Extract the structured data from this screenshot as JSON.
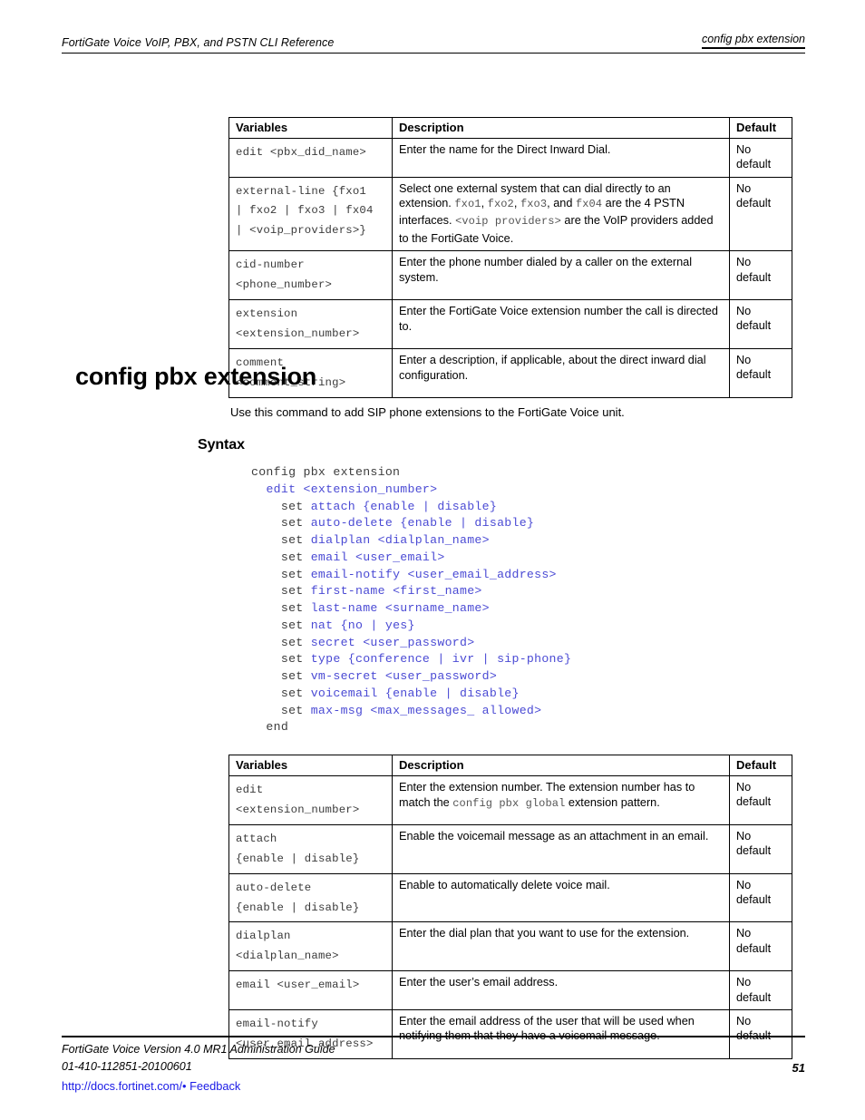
{
  "header": {
    "left": "FortiGate Voice VoIP, PBX, and PSTN CLI Reference",
    "right": "config pbx extension"
  },
  "table_did": {
    "columns": [
      "Variables",
      "Description",
      "Default"
    ],
    "rows": [
      {
        "variable": "edit <pbx_did_name>",
        "description": "Enter the name for the Direct Inward Dial.",
        "default": "No\ndefault"
      },
      {
        "variable": "external-line {fxo1\n| fxo2 | fxo3 | fx04\n| <voip_providers>}",
        "description_parts": [
          {
            "text": "Select one external system that can dial directly to an extension. ",
            "style": "plain"
          },
          {
            "text": "fxo1",
            "style": "mono"
          },
          {
            "text": ", ",
            "style": "plain"
          },
          {
            "text": "fxo2",
            "style": "mono"
          },
          {
            "text": ", ",
            "style": "plain"
          },
          {
            "text": "fxo3",
            "style": "mono"
          },
          {
            "text": ", and ",
            "style": "plain"
          },
          {
            "text": "fx04",
            "style": "mono"
          },
          {
            "text": " are the 4 PSTN interfaces. ",
            "style": "plain"
          },
          {
            "text": "<voip providers>",
            "style": "mono"
          },
          {
            "text": " are the VoIP providers added to the FortiGate Voice.",
            "style": "plain"
          }
        ],
        "default": "No\ndefault"
      },
      {
        "variable": "cid-number\n<phone_number>",
        "description": "Enter the phone number dialed by a caller on the external system.",
        "default": "No\ndefault"
      },
      {
        "variable": "extension\n<extension_number>",
        "description": "Enter the FortiGate Voice extension number the call is directed to.",
        "default": "No\ndefault"
      },
      {
        "variable": "comment\n<comment_string>",
        "description": "Enter a description, if applicable, about the direct inward dial configuration.",
        "default": "No\ndefault"
      }
    ]
  },
  "section": {
    "title": "config pbx extension",
    "intro": "Use this command to add SIP phone extensions to the FortiGate Voice unit.",
    "syntax_label": "Syntax"
  },
  "syntax": {
    "lines": [
      [
        {
          "t": "config pbx extension",
          "c": "kw"
        }
      ],
      [
        {
          "t": "  ",
          "c": "kw"
        },
        {
          "t": "edit <extension_number>",
          "c": "blue"
        }
      ],
      [
        {
          "t": "    set ",
          "c": "kw"
        },
        {
          "t": "attach {enable | disable}",
          "c": "blue"
        }
      ],
      [
        {
          "t": "    set ",
          "c": "kw"
        },
        {
          "t": "auto-delete {enable | disable}",
          "c": "blue"
        }
      ],
      [
        {
          "t": "    set ",
          "c": "kw"
        },
        {
          "t": "dialplan <dialplan_name>",
          "c": "blue"
        }
      ],
      [
        {
          "t": "    set ",
          "c": "kw"
        },
        {
          "t": "email <user_email>",
          "c": "blue"
        }
      ],
      [
        {
          "t": "    set ",
          "c": "kw"
        },
        {
          "t": "email-notify <user_email_address>",
          "c": "blue"
        }
      ],
      [
        {
          "t": "    set ",
          "c": "kw"
        },
        {
          "t": "first-name <first_name>",
          "c": "blue"
        }
      ],
      [
        {
          "t": "    set ",
          "c": "kw"
        },
        {
          "t": "last-name <surname_name>",
          "c": "blue"
        }
      ],
      [
        {
          "t": "    set ",
          "c": "kw"
        },
        {
          "t": "nat {no | yes}",
          "c": "blue"
        }
      ],
      [
        {
          "t": "    set ",
          "c": "kw"
        },
        {
          "t": "secret <user_password>",
          "c": "blue"
        }
      ],
      [
        {
          "t": "    set ",
          "c": "kw"
        },
        {
          "t": "type {conference | ivr | sip-phone}",
          "c": "blue"
        }
      ],
      [
        {
          "t": "    set ",
          "c": "kw"
        },
        {
          "t": "vm-secret <user_password>",
          "c": "blue"
        }
      ],
      [
        {
          "t": "    set ",
          "c": "kw"
        },
        {
          "t": "voicemail {enable | disable}",
          "c": "blue"
        }
      ],
      [
        {
          "t": "    set ",
          "c": "kw"
        },
        {
          "t": "max-msg <max_messages_ allowed>",
          "c": "blue"
        }
      ],
      [
        {
          "t": "  end",
          "c": "kw"
        }
      ]
    ]
  },
  "table_extension": {
    "columns": [
      "Variables",
      "Description",
      "Default"
    ],
    "rows": [
      {
        "variable": "edit\n<extension_number>",
        "description_parts": [
          {
            "text": "Enter the extension number. The extension number has to match the ",
            "style": "plain"
          },
          {
            "text": "config pbx global",
            "style": "mono"
          },
          {
            "text": " extension pattern.",
            "style": "plain"
          }
        ],
        "default": "No\ndefault"
      },
      {
        "variable": "attach\n{enable | disable}",
        "description": "Enable the voicemail message as an attachment in an email.",
        "default": "No\ndefault"
      },
      {
        "variable": "auto-delete\n{enable | disable}",
        "description": "Enable to automatically delete voice mail.",
        "default": "No\ndefault"
      },
      {
        "variable": "dialplan\n<dialplan_name>",
        "description": "Enter the dial plan that you want to use for the extension.",
        "default": "No\ndefault"
      },
      {
        "variable": "email <user_email>",
        "description": "Enter the user’s email address.",
        "default": "No\ndefault"
      },
      {
        "variable": "email-notify\n<user_email_address>",
        "description": "Enter the email address of the user that will be used when notifying them that they have a voicemail message.",
        "default": "No\ndefault"
      }
    ]
  },
  "footer": {
    "line1": "FortiGate Voice Version 4.0 MR1 Administration Guide",
    "line2": "01-410-112851-20100601",
    "link_url": "http://docs.fortinet.com/",
    "separator": "•",
    "link_feedback": "Feedback",
    "page_number": "51"
  }
}
